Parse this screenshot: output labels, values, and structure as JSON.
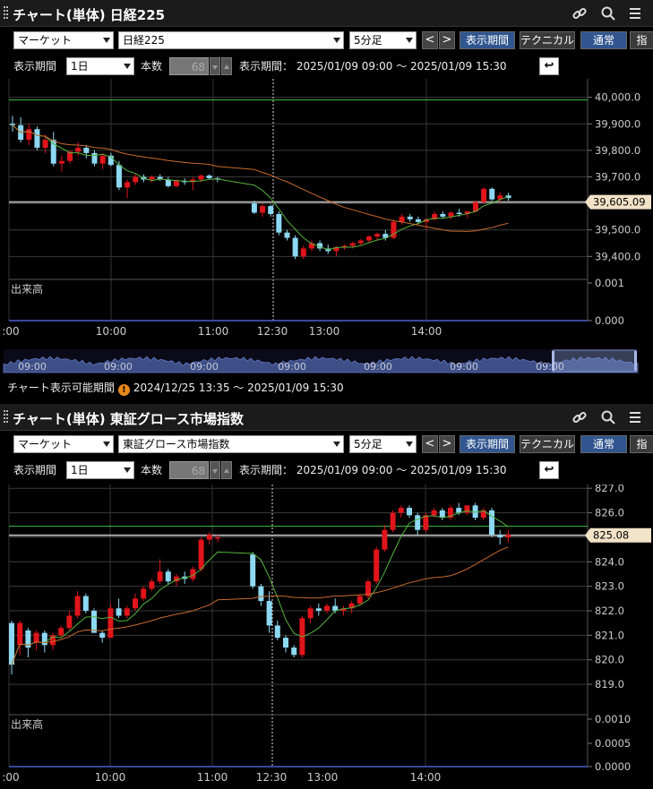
{
  "colors": {
    "up": "#e0151b",
    "down": "#8dd8f3",
    "ma_fast": "#55b43e",
    "ma_slow": "#c86a2e",
    "hline": "#42c142",
    "accent_btn": "#30558f"
  },
  "panel1": {
    "title": "チャート(単体) 日経225",
    "market_select": "マーケット",
    "symbol_select": "日経225",
    "interval_select": "5分足",
    "prev": "<",
    "next": ">",
    "period_button": "表示期間",
    "technical_button": "テクニカル",
    "normal_button": "通常",
    "cut_button": "指",
    "period_label": "表示期間",
    "period_select": "1日",
    "count_label": "本数",
    "count_value": "68",
    "range_text": "表示期間：  2025/01/09 09:00 ～ 2025/01/09 15:30",
    "volume_label": "出来高",
    "price_label": "39,605.09",
    "y_ticks": [
      "40,000.0",
      "39,900.0",
      "39,800.0",
      "39,700.0",
      "39,600.0",
      "39,500.0",
      "39,400.0"
    ],
    "vol_ticks": [
      "0.001",
      "0.000"
    ],
    "x_ticks": [
      ":00",
      "10:00",
      "11:00",
      "12:30",
      "13:00",
      "14:00"
    ],
    "nav_ticks": [
      "09:00",
      "09:00",
      "09:00",
      "09:00",
      "09:00",
      "09:00",
      "09:00"
    ],
    "available_label": "チャート表示可能期間",
    "available_range": "2024/12/25 13:35 ～ 2025/01/09 15:30",
    "warn_icon": "!"
  },
  "panel2": {
    "title": "チャート(単体) 東証グロース市場指数",
    "market_select": "マーケット",
    "symbol_select": "東証グロース市場指数",
    "interval_select": "5分足",
    "prev": "<",
    "next": ">",
    "period_button": "表示期間",
    "technical_button": "テクニカル",
    "normal_button": "通常",
    "cut_button": "指",
    "period_label": "表示期間",
    "period_select": "1日",
    "count_label": "本数",
    "count_value": "68",
    "range_text": "表示期間：  2025/01/09 09:00 ～ 2025/01/09 15:30",
    "volume_label": "出来高",
    "price_label": "825.08",
    "y_ticks": [
      "827.0",
      "826.0",
      "825.0",
      "824.0",
      "823.0",
      "822.0",
      "821.0",
      "820.0",
      "819.0"
    ],
    "vol_ticks": [
      "0.0010",
      "0.0005",
      "0.0000"
    ],
    "x_ticks": [
      ":00",
      "10:00",
      "11:00",
      "12:30",
      "13:00",
      "14:00"
    ]
  },
  "chart_data": [
    {
      "type": "candlestick",
      "title": "日経225",
      "ylim": [
        39320,
        40080
      ],
      "reference_line": 39990,
      "last_price": 39605.09,
      "candles": [
        [
          39900,
          39930,
          39870,
          39895
        ],
        [
          39895,
          39925,
          39830,
          39840
        ],
        [
          39840,
          39900,
          39820,
          39880
        ],
        [
          39880,
          39890,
          39800,
          39810
        ],
        [
          39810,
          39860,
          39790,
          39840
        ],
        [
          39840,
          39870,
          39740,
          39750
        ],
        [
          39750,
          39780,
          39720,
          39760
        ],
        [
          39760,
          39800,
          39750,
          39795
        ],
        [
          39795,
          39830,
          39780,
          39810
        ],
        [
          39810,
          39820,
          39770,
          39790
        ],
        [
          39790,
          39800,
          39740,
          39750
        ],
        [
          39750,
          39790,
          39730,
          39780
        ],
        [
          39780,
          39790,
          39740,
          39745
        ],
        [
          39745,
          39760,
          39650,
          39660
        ],
        [
          39660,
          39690,
          39620,
          39680
        ],
        [
          39680,
          39710,
          39670,
          39700
        ],
        [
          39700,
          39710,
          39680,
          39690
        ],
        [
          39690,
          39705,
          39680,
          39700
        ],
        [
          39700,
          39710,
          39685,
          39690
        ],
        [
          39690,
          39700,
          39660,
          39665
        ],
        [
          39665,
          39690,
          39660,
          39685
        ],
        [
          39685,
          39695,
          39670,
          39680
        ],
        [
          39680,
          39700,
          39650,
          39690
        ],
        [
          39690,
          39710,
          39680,
          39705
        ],
        [
          39705,
          39710,
          39690,
          39695
        ],
        [
          39695,
          39700,
          39680,
          39690
        ],
        [
          39600,
          39610,
          39560,
          39565
        ],
        [
          39565,
          39600,
          39550,
          39590
        ],
        [
          39590,
          39595,
          39550,
          39560
        ],
        [
          39560,
          39570,
          39480,
          39490
        ],
        [
          39490,
          39500,
          39460,
          39470
        ],
        [
          39470,
          39480,
          39390,
          39400
        ],
        [
          39400,
          39440,
          39390,
          39430
        ],
        [
          39430,
          39460,
          39420,
          39450
        ],
        [
          39450,
          39460,
          39420,
          39430
        ],
        [
          39430,
          39445,
          39410,
          39420
        ],
        [
          39420,
          39440,
          39400,
          39435
        ],
        [
          39435,
          39445,
          39425,
          39440
        ],
        [
          39440,
          39455,
          39430,
          39450
        ],
        [
          39450,
          39465,
          39440,
          39460
        ],
        [
          39460,
          39480,
          39450,
          39475
        ],
        [
          39475,
          39490,
          39460,
          39485
        ],
        [
          39485,
          39500,
          39460,
          39470
        ],
        [
          39470,
          39540,
          39465,
          39530
        ],
        [
          39530,
          39560,
          39520,
          39550
        ],
        [
          39550,
          39560,
          39530,
          39540
        ],
        [
          39540,
          39550,
          39525,
          39530
        ],
        [
          39530,
          39545,
          39500,
          39540
        ],
        [
          39540,
          39570,
          39535,
          39560
        ],
        [
          39560,
          39570,
          39545,
          39550
        ],
        [
          39550,
          39570,
          39540,
          39565
        ],
        [
          39565,
          39580,
          39550,
          39560
        ],
        [
          39560,
          39570,
          39545,
          39570
        ],
        [
          39570,
          39610,
          39565,
          39605
        ],
        [
          39605,
          39660,
          39600,
          39655
        ],
        [
          39655,
          39660,
          39610,
          39615
        ],
        [
          39615,
          39640,
          39605,
          39630
        ],
        [
          39630,
          39640,
          39610,
          39620
        ]
      ]
    },
    {
      "type": "candlestick",
      "title": "東証グロース市場指数",
      "ylim": [
        818.2,
        827.3
      ],
      "reference_line": 825.45,
      "last_price": 825.08,
      "candles": [
        [
          821.5,
          821.6,
          819.4,
          819.8
        ],
        [
          820.6,
          821.6,
          820.2,
          821.5
        ],
        [
          821.2,
          821.3,
          820.1,
          820.5
        ],
        [
          820.7,
          821.2,
          820.4,
          821.1
        ],
        [
          821.1,
          821.2,
          820.3,
          820.6
        ],
        [
          820.6,
          821.1,
          820.4,
          821.0
        ],
        [
          821.0,
          821.4,
          820.9,
          821.3
        ],
        [
          821.3,
          822.0,
          821.2,
          821.8
        ],
        [
          821.8,
          822.8,
          821.7,
          822.6
        ],
        [
          822.6,
          822.7,
          821.9,
          822.0
        ],
        [
          822.0,
          822.1,
          821.1,
          821.1
        ],
        [
          821.1,
          821.2,
          820.7,
          820.9
        ],
        [
          820.9,
          822.3,
          820.9,
          822.1
        ],
        [
          822.1,
          822.5,
          821.7,
          821.8
        ],
        [
          821.8,
          822.2,
          821.7,
          822.1
        ],
        [
          822.1,
          822.7,
          822.0,
          822.5
        ],
        [
          822.5,
          823.0,
          822.4,
          822.9
        ],
        [
          822.9,
          823.3,
          822.8,
          823.2
        ],
        [
          823.2,
          824.1,
          823.1,
          823.6
        ],
        [
          823.6,
          823.7,
          823.1,
          823.2
        ],
        [
          823.2,
          823.5,
          823.0,
          823.4
        ],
        [
          823.4,
          823.6,
          823.1,
          823.3
        ],
        [
          823.3,
          823.8,
          823.2,
          823.7
        ],
        [
          823.7,
          825.0,
          823.6,
          824.9
        ],
        [
          824.9,
          825.2,
          824.7,
          825.1
        ],
        [
          825.0,
          825.1,
          824.8,
          825.0
        ],
        [
          824.3,
          824.4,
          822.9,
          823.0
        ],
        [
          823.0,
          823.1,
          822.2,
          822.4
        ],
        [
          822.4,
          822.8,
          821.1,
          821.4
        ],
        [
          821.4,
          821.6,
          820.8,
          820.9
        ],
        [
          820.9,
          821.0,
          820.3,
          820.5
        ],
        [
          820.5,
          820.6,
          820.1,
          820.2
        ],
        [
          820.2,
          821.8,
          820.1,
          821.7
        ],
        [
          821.7,
          822.2,
          821.5,
          822.1
        ],
        [
          822.1,
          822.3,
          821.8,
          822.0
        ],
        [
          822.0,
          822.3,
          821.9,
          822.2
        ],
        [
          822.2,
          822.5,
          821.9,
          822.0
        ],
        [
          822.0,
          822.2,
          821.8,
          822.1
        ],
        [
          822.1,
          822.4,
          821.9,
          822.3
        ],
        [
          822.3,
          822.7,
          822.2,
          822.6
        ],
        [
          822.6,
          823.3,
          822.5,
          823.2
        ],
        [
          823.2,
          824.6,
          823.1,
          824.5
        ],
        [
          824.5,
          825.5,
          824.4,
          825.3
        ],
        [
          825.3,
          826.1,
          825.2,
          826.0
        ],
        [
          826.0,
          826.3,
          825.8,
          826.2
        ],
        [
          826.2,
          826.3,
          825.8,
          825.9
        ],
        [
          825.9,
          826.0,
          825.1,
          825.3
        ],
        [
          825.3,
          826.0,
          825.2,
          825.9
        ],
        [
          825.9,
          826.2,
          825.8,
          826.1
        ],
        [
          826.1,
          826.2,
          825.7,
          825.8
        ],
        [
          825.8,
          826.3,
          825.7,
          826.2
        ],
        [
          826.2,
          826.4,
          825.9,
          826.0
        ],
        [
          826.0,
          826.3,
          825.9,
          826.3
        ],
        [
          826.3,
          826.4,
          825.7,
          825.8
        ],
        [
          825.8,
          826.2,
          825.7,
          826.1
        ],
        [
          826.1,
          826.2,
          825.0,
          825.1
        ],
        [
          825.1,
          825.3,
          824.7,
          825.0
        ],
        [
          825.0,
          825.3,
          824.8,
          825.1
        ]
      ]
    }
  ]
}
